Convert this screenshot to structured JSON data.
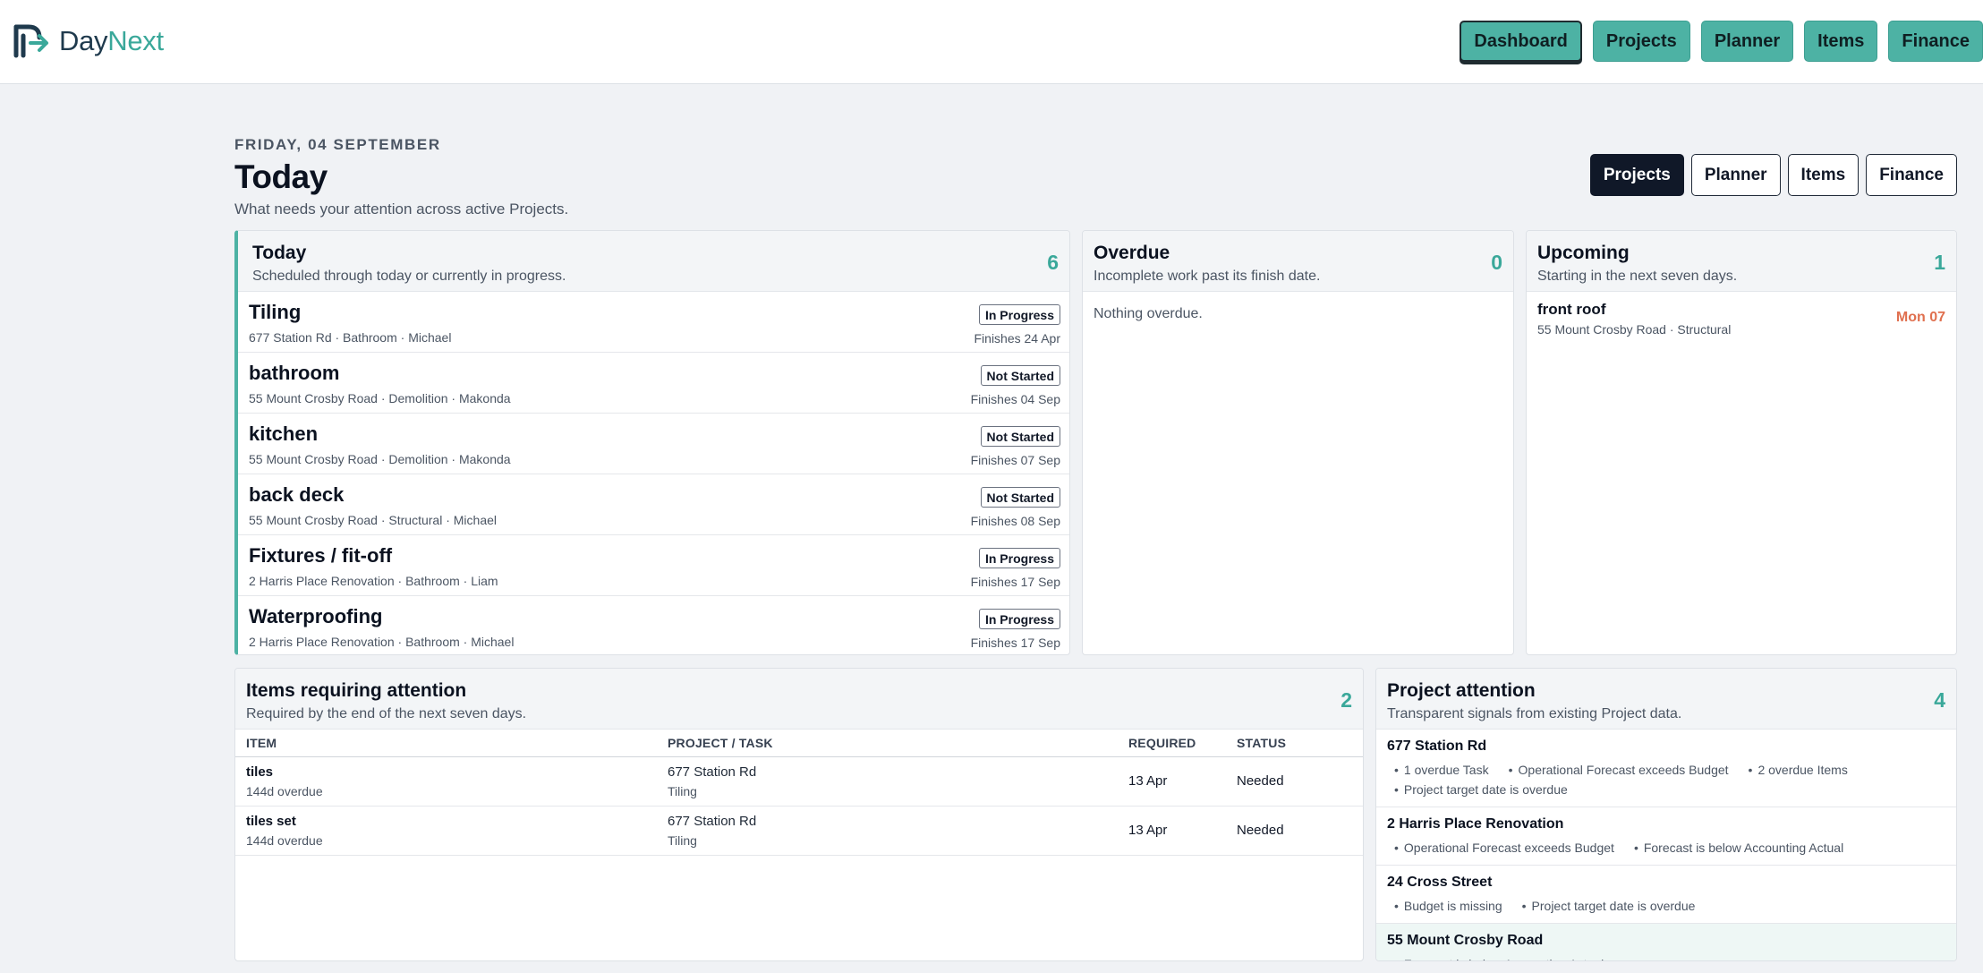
{
  "brand": {
    "day": "Day",
    "next": "Next"
  },
  "topnav": [
    "Dashboard",
    "Projects",
    "Planner",
    "Items",
    "Finance"
  ],
  "header": {
    "date": "FRIDAY, 04 SEPTEMBER",
    "title": "Today",
    "subtitle": "What needs your attention across active Projects."
  },
  "quicknav": [
    "Projects",
    "Planner",
    "Items",
    "Finance"
  ],
  "today": {
    "title": "Today",
    "subtitle": "Scheduled through today or currently in progress.",
    "count": "6",
    "tasks": [
      {
        "name": "Tiling",
        "meta": "677 Station Rd · Bathroom · Michael",
        "status": "In Progress",
        "finish": "Finishes 24 Apr"
      },
      {
        "name": "bathroom",
        "meta": "55 Mount Crosby Road · Demolition · Makonda",
        "status": "Not Started",
        "finish": "Finishes 04 Sep"
      },
      {
        "name": "kitchen",
        "meta": "55 Mount Crosby Road · Demolition · Makonda",
        "status": "Not Started",
        "finish": "Finishes 07 Sep"
      },
      {
        "name": "back deck",
        "meta": "55 Mount Crosby Road · Structural · Michael",
        "status": "Not Started",
        "finish": "Finishes 08 Sep"
      },
      {
        "name": "Fixtures / fit-off",
        "meta": "2 Harris Place Renovation · Bathroom · Liam",
        "status": "In Progress",
        "finish": "Finishes 17 Sep"
      },
      {
        "name": "Waterproofing",
        "meta": "2 Harris Place Renovation · Bathroom · Michael",
        "status": "In Progress",
        "finish": "Finishes 17 Sep"
      }
    ]
  },
  "overdue": {
    "title": "Overdue",
    "subtitle": "Incomplete work past its finish date.",
    "count": "0",
    "empty": "Nothing overdue."
  },
  "upcoming": {
    "title": "Upcoming",
    "subtitle": "Starting in the next seven days.",
    "count": "1",
    "items": [
      {
        "name": "front roof",
        "meta": "55 Mount Crosby Road · Structural",
        "date": "Mon 07"
      }
    ]
  },
  "items_attention": {
    "title": "Items requiring attention",
    "subtitle": "Required by the end of the next seven days.",
    "count": "2",
    "columns": [
      "ITEM",
      "PROJECT / TASK",
      "REQUIRED",
      "STATUS"
    ],
    "rows": [
      {
        "item": "tiles",
        "overdue": "144d overdue",
        "project": "677 Station Rd",
        "task": "Tiling",
        "required": "13 Apr",
        "status": "Needed"
      },
      {
        "item": "tiles set",
        "overdue": "144d overdue",
        "project": "677 Station Rd",
        "task": "Tiling",
        "required": "13 Apr",
        "status": "Needed"
      }
    ]
  },
  "project_attention": {
    "title": "Project attention",
    "subtitle": "Transparent signals from existing Project data.",
    "count": "4",
    "projects": [
      {
        "name": "677 Station Rd",
        "signals": [
          "1 overdue Task",
          "Operational Forecast exceeds Budget",
          "2 overdue Items",
          "Project target date is overdue"
        ]
      },
      {
        "name": "2 Harris Place Renovation",
        "signals": [
          "Operational Forecast exceeds Budget",
          "Forecast is below Accounting Actual"
        ]
      },
      {
        "name": "24 Cross Street",
        "signals": [
          "Budget is missing",
          "Project target date is overdue"
        ]
      },
      {
        "name": "55 Mount Crosby Road",
        "signals": [
          "Forecast is below Accounting Actual"
        ]
      }
    ]
  },
  "colors": {
    "accent": "#4db2a4",
    "count": "#3aa89a",
    "upcoming_date": "#e0704f",
    "dark": "#101828"
  }
}
